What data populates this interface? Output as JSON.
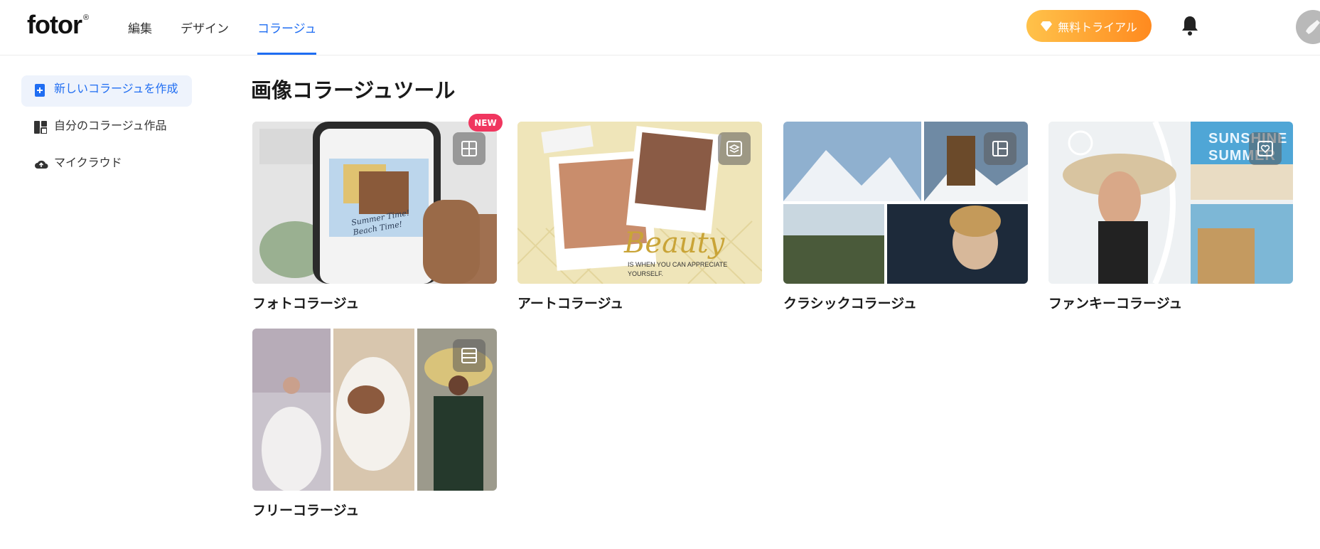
{
  "header": {
    "logo": "fotor",
    "logo_mark": "®",
    "nav": [
      {
        "label": "編集",
        "active": false
      },
      {
        "label": "デザイン",
        "active": false
      },
      {
        "label": "コラージュ",
        "active": true
      }
    ],
    "trial_label": "無料トライアル",
    "trial_icon": "diamond-icon",
    "bell_icon": "bell-icon",
    "accent_color": "#1f6df2"
  },
  "sidebar": {
    "items": [
      {
        "label": "新しいコラージュを作成",
        "icon": "new-document-icon",
        "active": true
      },
      {
        "label": "自分のコラージュ作品",
        "icon": "collage-layout-icon",
        "active": false
      },
      {
        "label": "マイクラウド",
        "icon": "cloud-upload-icon",
        "active": false
      }
    ]
  },
  "main": {
    "title": "画像コラージュツール",
    "new_badge": "NEW",
    "cards": [
      {
        "label": "フォトコラージュ",
        "badge_icon": "grid-layout-icon",
        "thumb_text": "Summer Time! Beach Time!"
      },
      {
        "label": "アートコラージュ",
        "badge_icon": "layers-icon",
        "thumb_text": "Beauty",
        "thumb_subtext": "IS WHEN YOU CAN APPRECIATE YOURSELF."
      },
      {
        "label": "クラシックコラージュ",
        "badge_icon": "split-layout-icon"
      },
      {
        "label": "ファンキーコラージュ",
        "badge_icon": "heart-frame-icon",
        "thumb_text": "SUNSHINE SUMMER"
      },
      {
        "label": "フリーコラージュ",
        "badge_icon": "rows-layout-icon"
      }
    ]
  }
}
